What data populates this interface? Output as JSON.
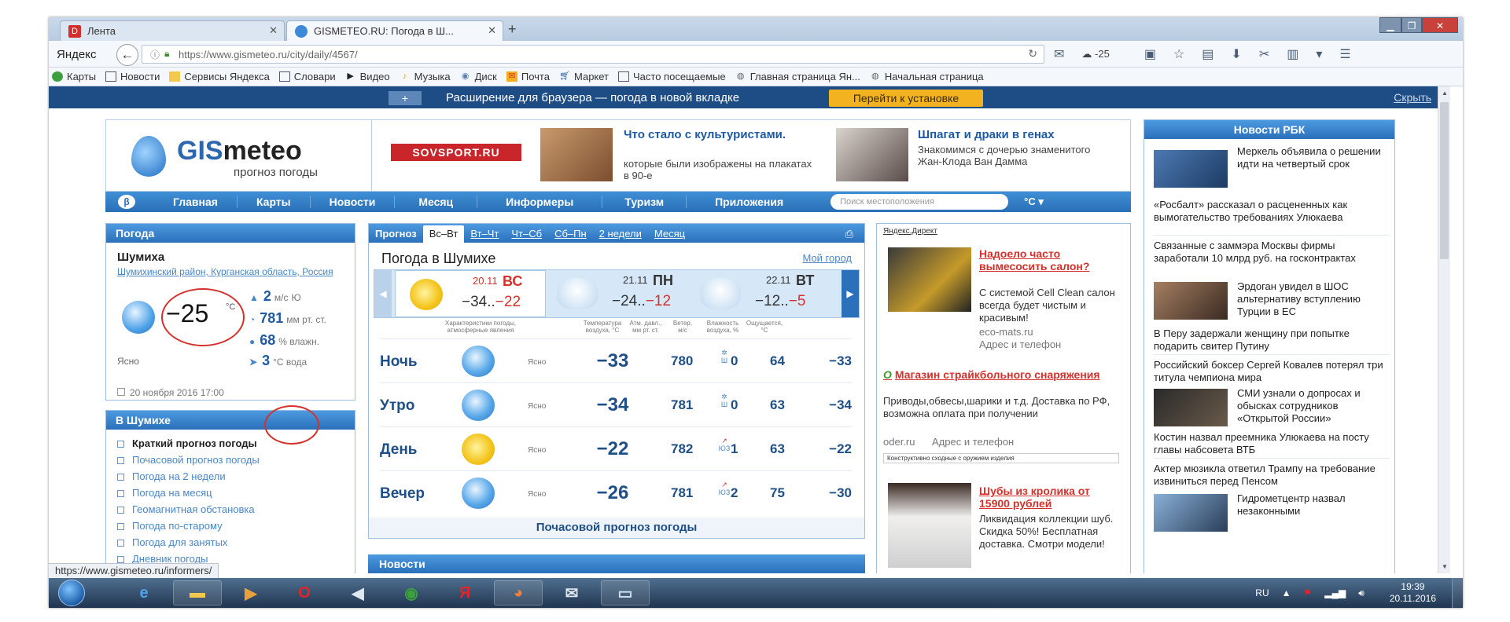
{
  "browser": {
    "tabs": [
      {
        "label": "Лента",
        "icon": "D"
      },
      {
        "label": "GISMETEO.RU: Погода в Ш...",
        "icon": "gismeteo-favicon"
      }
    ],
    "yandex_label": "Яндекс",
    "url": "https://www.gismeteo.ru/city/daily/4567/",
    "weather_widget": "-25",
    "bookmarks": [
      "Карты",
      "Новости",
      "Сервисы Яндекса",
      "Словари",
      "Видео",
      "Музыка",
      "Диск",
      "Почта",
      "Маркет",
      "Часто посещаемые",
      "Главная страница Ян...",
      "Начальная страница"
    ]
  },
  "notification": {
    "plus": "+",
    "text": "Расширение для браузера — погода в новой вкладке",
    "install": "Перейти к установке",
    "hide": "Скрыть"
  },
  "header": {
    "logo_main": "GISmeteo",
    "logo_sub": "прогноз погоды",
    "sovsport": "SOVSPORT.RU",
    "ad1": {
      "title": "Что стало с культуристами.",
      "desc": "которые были изображены на плакатах в 90-е"
    },
    "ad2": {
      "title": "Шпагат и драки в генах",
      "desc": "Знакомимся с дочерью знаменитого Жан-Клода Ван Дамма"
    }
  },
  "menu": {
    "beta": "β",
    "items": [
      "Главная",
      "Карты",
      "Новости",
      "Месяц",
      "Информеры",
      "Туризм",
      "Приложения"
    ],
    "search_placeholder": "Поиск местоположения",
    "unit": "°C ▾"
  },
  "now": {
    "header": "Погода",
    "city": "Шумиха",
    "region": "Шумихинский район, Курганская область, Россия",
    "temp": "−25",
    "temp_unit": "°C",
    "wind": "2",
    "wind_unit": "м/с",
    "wind_dir": "Ю",
    "pressure": "781",
    "pressure_unit": "мм рт. ст.",
    "humidity": "68",
    "humidity_unit": "% влажн.",
    "water": "3",
    "water_unit": "°C вода",
    "sky": "Ясно",
    "date": "20 ноября 2016 17:00"
  },
  "city_links": {
    "header": "В Шумихе",
    "items": [
      "Краткий прогноз погоды",
      "Почасовой прогноз погоды",
      "Погода на 2 недели",
      "Погода на месяц",
      "Геомагнитная обстановка",
      "Погода по-старому",
      "Погода для занятых",
      "Дневник погоды"
    ]
  },
  "forecast": {
    "tabs": [
      "Прогноз",
      "Вс–Вт",
      "Вт–Чт",
      "Чт–Сб",
      "Сб–Пн",
      "2 недели",
      "Месяц"
    ],
    "title": "Погода в Шумихе",
    "my_city": "Мой город",
    "days": [
      {
        "date": "20.11",
        "dow": "ВС",
        "temps": "−34..−22"
      },
      {
        "date": "21.11",
        "dow": "ПН",
        "temps": "−24..−12"
      },
      {
        "date": "22.11",
        "dow": "ВТ",
        "temps": "−12..−5"
      }
    ],
    "col_heads": {
      "chars": "Характеристики погоды, атмосферные явления",
      "temp": "Температура воздуха, °C",
      "pressure": "Атм. давл., мм рт. ст.",
      "wind": "Ветер, м/с",
      "humidity": "Влажность воздуха, %",
      "feels": "Ощущается, °C"
    },
    "rows": [
      {
        "part": "Ночь",
        "sky": "Ясно",
        "temp": "−33",
        "pressure": "780",
        "wind_dir": "Ш",
        "wind": "0",
        "humidity": "64",
        "feels": "−33",
        "icon": "moon"
      },
      {
        "part": "Утро",
        "sky": "Ясно",
        "temp": "−34",
        "pressure": "781",
        "wind_dir": "Ш",
        "wind": "0",
        "humidity": "63",
        "feels": "−34",
        "icon": "moon"
      },
      {
        "part": "День",
        "sky": "Ясно",
        "temp": "−22",
        "pressure": "782",
        "wind_dir": "ЮЗ",
        "wind": "1",
        "humidity": "63",
        "feels": "−22",
        "icon": "sun"
      },
      {
        "part": "Вечер",
        "sky": "Ясно",
        "temp": "−26",
        "pressure": "781",
        "wind_dir": "ЮЗ",
        "wind": "2",
        "humidity": "75",
        "feels": "−30",
        "icon": "moon"
      }
    ],
    "hourly_link": "Почасовой прогноз погоды",
    "news_header": "Новости"
  },
  "direct": {
    "label": "Яндекс.Директ",
    "ad1": {
      "title": "Надоело часто вымесосить салон?",
      "text": "С системой Cell Clean салон всегда будет чистым и красивым!",
      "domain": "eco-mats.ru",
      "contacts": "Адрес и телефон"
    },
    "ad2": {
      "title": "Магазин страйкбольного снаряжения",
      "text": "Приводы,обвесы,шарики и т.д. Доставка по РФ, возможна оплата при получении",
      "domain": "oder.ru",
      "contacts": "Адрес и телефон",
      "note": "Конструктивно сходные с оружием изделия"
    },
    "ad3": {
      "title": "Шубы из кролика от 15900 рублей",
      "text": "Ликвидация коллекции шуб. Скидка 50%! Бесплатная доставка. Смотри модели!"
    }
  },
  "rbc": {
    "header": "Новости РБК",
    "items": [
      {
        "text": "Меркель объявила о решении идти на четвертый срок",
        "image": true
      },
      {
        "text": "«Росбалт» рассказал о расцененных как вымогательство требованиях Улюкаева",
        "image": false
      },
      {
        "text": "Связанные с заммэра Москвы фирмы заработали 10 млрд руб. на госконтрактах",
        "image": false
      },
      {
        "text": "Эрдоган увидел в ШОС альтернативу вступлению Турции в ЕС",
        "image": true
      },
      {
        "text": "В Перу задержали женщину при попытке подарить свитер Путину",
        "image": false
      },
      {
        "text": "Российский боксер Сергей Ковалев потерял три титула чемпиона мира",
        "image": false
      },
      {
        "text": "СМИ узнали о допросах и обысках сотрудников «Открытой России»",
        "image": true
      },
      {
        "text": "Костин назвал преемника Улюкаева на посту главы набсовета ВТБ",
        "image": false
      },
      {
        "text": "Актер мюзикла ответил Трампу на требование извиниться перед Пенсом",
        "image": false
      },
      {
        "text": "Гидрометцентр назвал незаконными",
        "image": true
      }
    ]
  },
  "status_url": "https://www.gismeteo.ru/informers/",
  "taskbar": {
    "lang": "RU",
    "time": "19:39",
    "date": "20.11.2016"
  }
}
